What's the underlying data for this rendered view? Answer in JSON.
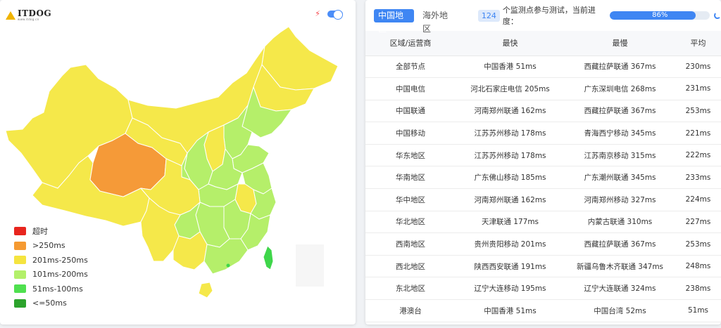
{
  "logo": {
    "text": "ITDOG",
    "subtext": "www.itdog.cn"
  },
  "toolbar": {
    "bolt_icon": "bolt-icon",
    "toggle_icon": "toggle-switch-icon"
  },
  "legend": [
    {
      "label": "超时",
      "color": "#e8251e"
    },
    {
      "label": ">250ms",
      "color": "#f59a32"
    },
    {
      "label": "201ms-250ms",
      "color": "#f5e43f"
    },
    {
      "label": "101ms-200ms",
      "color": "#b3f06a"
    },
    {
      "label": "51ms-100ms",
      "color": "#4fe04f"
    },
    {
      "label": "<=50ms",
      "color": "#2ca32c"
    }
  ],
  "tabs": [
    {
      "label": "中国地区",
      "active": true
    },
    {
      "label": "海外地区",
      "active": false
    }
  ],
  "status": {
    "count": "124",
    "text": "个监测点参与测试，当前进度：",
    "progress": 86,
    "progress_label": "86%"
  },
  "table": {
    "headers": [
      "区域/运营商",
      "最快",
      "最慢",
      "平均"
    ],
    "rows": [
      [
        "全部节点",
        "中国香港 51ms",
        "西藏拉萨联通 367ms",
        "230ms"
      ],
      [
        "中国电信",
        "河北石家庄电信 205ms",
        "广东深圳电信 268ms",
        "231ms"
      ],
      [
        "中国联通",
        "河南郑州联通 162ms",
        "西藏拉萨联通 367ms",
        "253ms"
      ],
      [
        "中国移动",
        "江苏苏州移动 178ms",
        "青海西宁移动 345ms",
        "221ms"
      ],
      [
        "华东地区",
        "江苏苏州移动 178ms",
        "江苏南京移动 315ms",
        "222ms"
      ],
      [
        "华南地区",
        "广东佛山移动 185ms",
        "广东潮州联通 345ms",
        "233ms"
      ],
      [
        "华中地区",
        "河南郑州联通 162ms",
        "河南郑州移动 327ms",
        "224ms"
      ],
      [
        "华北地区",
        "天津联通 177ms",
        "内蒙古联通 310ms",
        "227ms"
      ],
      [
        "西南地区",
        "贵州贵阳移动 201ms",
        "西藏拉萨联通 367ms",
        "253ms"
      ],
      [
        "西北地区",
        "陕西西安联通 191ms",
        "新疆乌鲁木齐联通 347ms",
        "248ms"
      ],
      [
        "东北地区",
        "辽宁大连移动 195ms",
        "辽宁大连联通 324ms",
        "238ms"
      ],
      [
        "港澳台",
        "中国香港 51ms",
        "中国台湾 52ms",
        "51ms"
      ]
    ]
  }
}
